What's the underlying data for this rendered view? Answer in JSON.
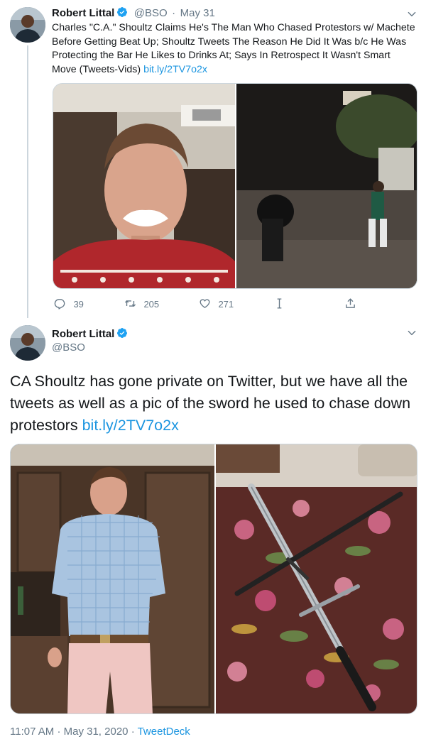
{
  "tweet1": {
    "name": "Robert Littal",
    "handle": "@BSO",
    "separator": "·",
    "date": "May 31",
    "text": "Charles \"C.A.\" Shoultz Claims He's The Man Who Chased Protestors w/ Machete Before Getting Beat Up; Shoultz Tweets The Reason He Did It Was b/c He Was Protecting the Bar He Likes to Drinks At; Says In Retrospect It Wasn't Smart Move (Tweets-Vids)",
    "link": "bit.ly/2TV7o2x",
    "replies": "39",
    "retweets": "205",
    "likes": "271"
  },
  "tweet2": {
    "name": "Robert Littal",
    "handle": "@BSO",
    "text": "CA Shoultz has gone private on Twitter, but we have all the tweets as well as a pic of the sword he used to chase down protestors",
    "link": "bit.ly/2TV7o2x",
    "time": "11:07 AM",
    "separator": "·",
    "date": "May 31, 2020",
    "separator2": "·",
    "source": "TweetDeck"
  },
  "colors": {
    "link": "#1b95e0",
    "secondary_text": "#657786",
    "verified": "#1da1f2",
    "border": "#ccd6dd"
  },
  "icons": [
    "verified-badge-icon",
    "chevron-down-icon",
    "reply-icon",
    "retweet-icon",
    "like-icon",
    "analytics-icon",
    "share-icon"
  ]
}
